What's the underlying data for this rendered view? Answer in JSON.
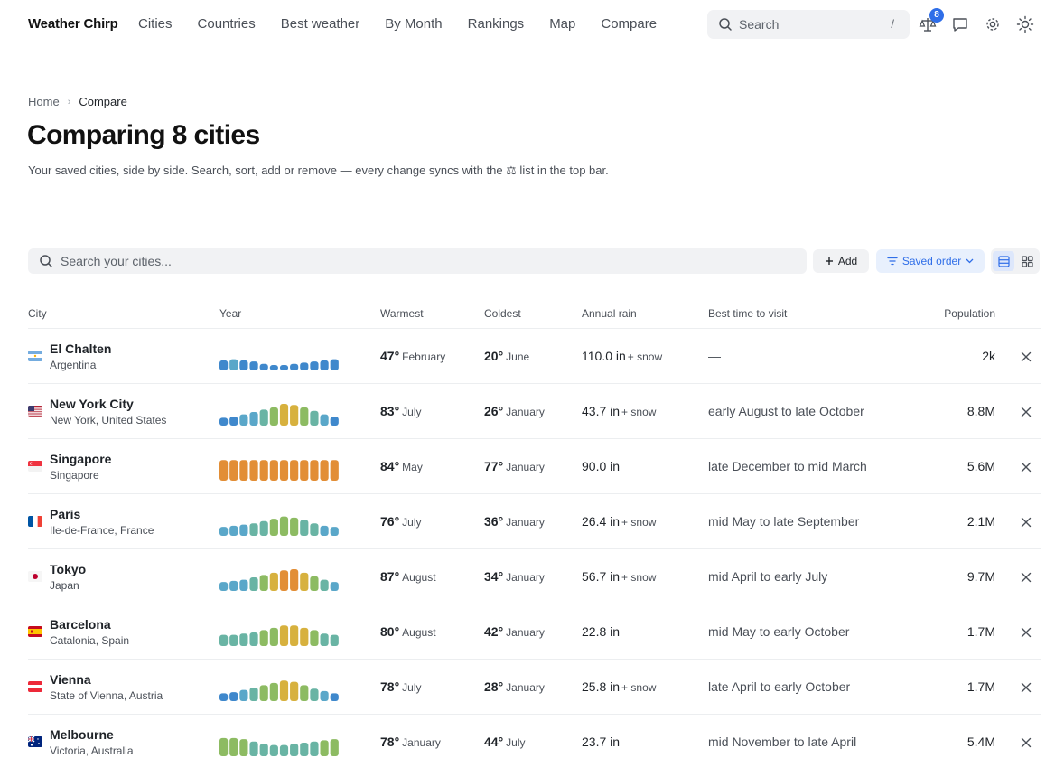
{
  "brand": "Weather Chirp",
  "nav": [
    "Cities",
    "Countries",
    "Best weather",
    "By Month",
    "Rankings",
    "Map",
    "Compare"
  ],
  "search": {
    "placeholder": "Search",
    "shortcut": "/"
  },
  "compare_badge": "8",
  "breadcrumb": {
    "home": "Home",
    "current": "Compare"
  },
  "title": "Comparing 8 cities",
  "description": "Your saved cities, side by side. Search, sort, add or remove — every change syncs with the ⚖ list in the top bar.",
  "toolbar": {
    "filter_placeholder": "Search your cities...",
    "add_label": "Add",
    "sort_label": "Saved order"
  },
  "columns": {
    "city": "City",
    "year": "Year",
    "warmest": "Warmest",
    "coldest": "Coldest",
    "rain": "Annual rain",
    "best": "Best time to visit",
    "population": "Population"
  },
  "colors": {
    "cold": "#3f88cc",
    "cool": "#5aa7c9",
    "mild": "#69b4a4",
    "warm": "#8dbb62",
    "hot": "#d7b13e",
    "hotter": "#e28e36",
    "accent": "#2f6ee8"
  },
  "cities": [
    {
      "name": "El Chalten",
      "region": "Argentina",
      "flag": "ar",
      "warm_t": "47°",
      "warm_m": "February",
      "cold_t": "20°",
      "cold_m": "June",
      "rain": "110.0 in",
      "snow": "+ snow",
      "best": "—",
      "pop": "2k",
      "year": [
        {
          "h": 0.5,
          "c": "cold"
        },
        {
          "h": 0.55,
          "c": "cool"
        },
        {
          "h": 0.5,
          "c": "cold"
        },
        {
          "h": 0.45,
          "c": "cold"
        },
        {
          "h": 0.35,
          "c": "cold"
        },
        {
          "h": 0.3,
          "c": "cold"
        },
        {
          "h": 0.3,
          "c": "cold"
        },
        {
          "h": 0.35,
          "c": "cold"
        },
        {
          "h": 0.4,
          "c": "cold"
        },
        {
          "h": 0.45,
          "c": "cold"
        },
        {
          "h": 0.5,
          "c": "cold"
        },
        {
          "h": 0.55,
          "c": "cold"
        }
      ]
    },
    {
      "name": "New York City",
      "region": "New York, United States",
      "flag": "us",
      "warm_t": "83°",
      "warm_m": "July",
      "cold_t": "26°",
      "cold_m": "January",
      "rain": "43.7 in",
      "snow": "+ snow",
      "best": "early August to late October",
      "pop": "8.8M",
      "year": [
        {
          "h": 0.4,
          "c": "cold"
        },
        {
          "h": 0.45,
          "c": "cold"
        },
        {
          "h": 0.55,
          "c": "cool"
        },
        {
          "h": 0.65,
          "c": "cool"
        },
        {
          "h": 0.75,
          "c": "mild"
        },
        {
          "h": 0.85,
          "c": "warm"
        },
        {
          "h": 1.0,
          "c": "hot"
        },
        {
          "h": 0.95,
          "c": "hot"
        },
        {
          "h": 0.85,
          "c": "warm"
        },
        {
          "h": 0.7,
          "c": "mild"
        },
        {
          "h": 0.55,
          "c": "cool"
        },
        {
          "h": 0.45,
          "c": "cold"
        }
      ]
    },
    {
      "name": "Singapore",
      "region": "Singapore",
      "flag": "sg",
      "warm_t": "84°",
      "warm_m": "May",
      "cold_t": "77°",
      "cold_m": "January",
      "rain": "90.0 in",
      "snow": "",
      "best": "late December to mid March",
      "pop": "5.6M",
      "year": [
        {
          "h": 0.95,
          "c": "hotter"
        },
        {
          "h": 0.95,
          "c": "hotter"
        },
        {
          "h": 0.95,
          "c": "hotter"
        },
        {
          "h": 0.95,
          "c": "hotter"
        },
        {
          "h": 0.95,
          "c": "hotter"
        },
        {
          "h": 0.95,
          "c": "hotter"
        },
        {
          "h": 0.95,
          "c": "hotter"
        },
        {
          "h": 0.95,
          "c": "hotter"
        },
        {
          "h": 0.95,
          "c": "hotter"
        },
        {
          "h": 0.95,
          "c": "hotter"
        },
        {
          "h": 0.95,
          "c": "hotter"
        },
        {
          "h": 0.95,
          "c": "hotter"
        }
      ]
    },
    {
      "name": "Paris",
      "region": "Ile-de-France, France",
      "flag": "fr",
      "warm_t": "76°",
      "warm_m": "July",
      "cold_t": "36°",
      "cold_m": "January",
      "rain": "26.4 in",
      "snow": "+ snow",
      "best": "mid May to late September",
      "pop": "2.1M",
      "year": [
        {
          "h": 0.45,
          "c": "cool"
        },
        {
          "h": 0.5,
          "c": "cool"
        },
        {
          "h": 0.55,
          "c": "cool"
        },
        {
          "h": 0.6,
          "c": "mild"
        },
        {
          "h": 0.7,
          "c": "mild"
        },
        {
          "h": 0.8,
          "c": "warm"
        },
        {
          "h": 0.9,
          "c": "warm"
        },
        {
          "h": 0.85,
          "c": "warm"
        },
        {
          "h": 0.75,
          "c": "mild"
        },
        {
          "h": 0.6,
          "c": "mild"
        },
        {
          "h": 0.5,
          "c": "cool"
        },
        {
          "h": 0.45,
          "c": "cool"
        }
      ]
    },
    {
      "name": "Tokyo",
      "region": "Japan",
      "flag": "jp",
      "warm_t": "87°",
      "warm_m": "August",
      "cold_t": "34°",
      "cold_m": "January",
      "rain": "56.7 in",
      "snow": "+ snow",
      "best": "mid April to early July",
      "pop": "9.7M",
      "year": [
        {
          "h": 0.45,
          "c": "cool"
        },
        {
          "h": 0.5,
          "c": "cool"
        },
        {
          "h": 0.55,
          "c": "cool"
        },
        {
          "h": 0.65,
          "c": "mild"
        },
        {
          "h": 0.75,
          "c": "warm"
        },
        {
          "h": 0.85,
          "c": "hot"
        },
        {
          "h": 0.95,
          "c": "hotter"
        },
        {
          "h": 1.0,
          "c": "hotter"
        },
        {
          "h": 0.85,
          "c": "hot"
        },
        {
          "h": 0.7,
          "c": "warm"
        },
        {
          "h": 0.55,
          "c": "mild"
        },
        {
          "h": 0.45,
          "c": "cool"
        }
      ]
    },
    {
      "name": "Barcelona",
      "region": "Catalonia, Spain",
      "flag": "es",
      "warm_t": "80°",
      "warm_m": "August",
      "cold_t": "42°",
      "cold_m": "January",
      "rain": "22.8 in",
      "snow": "",
      "best": "mid May to early October",
      "pop": "1.7M",
      "year": [
        {
          "h": 0.55,
          "c": "mild"
        },
        {
          "h": 0.55,
          "c": "mild"
        },
        {
          "h": 0.6,
          "c": "mild"
        },
        {
          "h": 0.65,
          "c": "mild"
        },
        {
          "h": 0.75,
          "c": "warm"
        },
        {
          "h": 0.85,
          "c": "warm"
        },
        {
          "h": 0.95,
          "c": "hot"
        },
        {
          "h": 0.95,
          "c": "hot"
        },
        {
          "h": 0.85,
          "c": "hot"
        },
        {
          "h": 0.75,
          "c": "warm"
        },
        {
          "h": 0.6,
          "c": "mild"
        },
        {
          "h": 0.55,
          "c": "mild"
        }
      ]
    },
    {
      "name": "Vienna",
      "region": "State of Vienna, Austria",
      "flag": "at",
      "warm_t": "78°",
      "warm_m": "July",
      "cold_t": "28°",
      "cold_m": "January",
      "rain": "25.8 in",
      "snow": "+ snow",
      "best": "late April to early October",
      "pop": "1.7M",
      "year": [
        {
          "h": 0.4,
          "c": "cold"
        },
        {
          "h": 0.45,
          "c": "cold"
        },
        {
          "h": 0.55,
          "c": "cool"
        },
        {
          "h": 0.65,
          "c": "mild"
        },
        {
          "h": 0.75,
          "c": "warm"
        },
        {
          "h": 0.85,
          "c": "warm"
        },
        {
          "h": 0.95,
          "c": "hot"
        },
        {
          "h": 0.9,
          "c": "hot"
        },
        {
          "h": 0.75,
          "c": "warm"
        },
        {
          "h": 0.6,
          "c": "mild"
        },
        {
          "h": 0.5,
          "c": "cool"
        },
        {
          "h": 0.4,
          "c": "cold"
        }
      ]
    },
    {
      "name": "Melbourne",
      "region": "Victoria, Australia",
      "flag": "au",
      "warm_t": "78°",
      "warm_m": "January",
      "cold_t": "44°",
      "cold_m": "July",
      "rain": "23.7 in",
      "snow": "",
      "best": "mid November to late April",
      "pop": "5.4M",
      "year": [
        {
          "h": 0.85,
          "c": "warm"
        },
        {
          "h": 0.85,
          "c": "warm"
        },
        {
          "h": 0.8,
          "c": "warm"
        },
        {
          "h": 0.7,
          "c": "mild"
        },
        {
          "h": 0.6,
          "c": "mild"
        },
        {
          "h": 0.55,
          "c": "mild"
        },
        {
          "h": 0.55,
          "c": "mild"
        },
        {
          "h": 0.6,
          "c": "mild"
        },
        {
          "h": 0.65,
          "c": "mild"
        },
        {
          "h": 0.7,
          "c": "mild"
        },
        {
          "h": 0.75,
          "c": "warm"
        },
        {
          "h": 0.8,
          "c": "warm"
        }
      ]
    }
  ]
}
